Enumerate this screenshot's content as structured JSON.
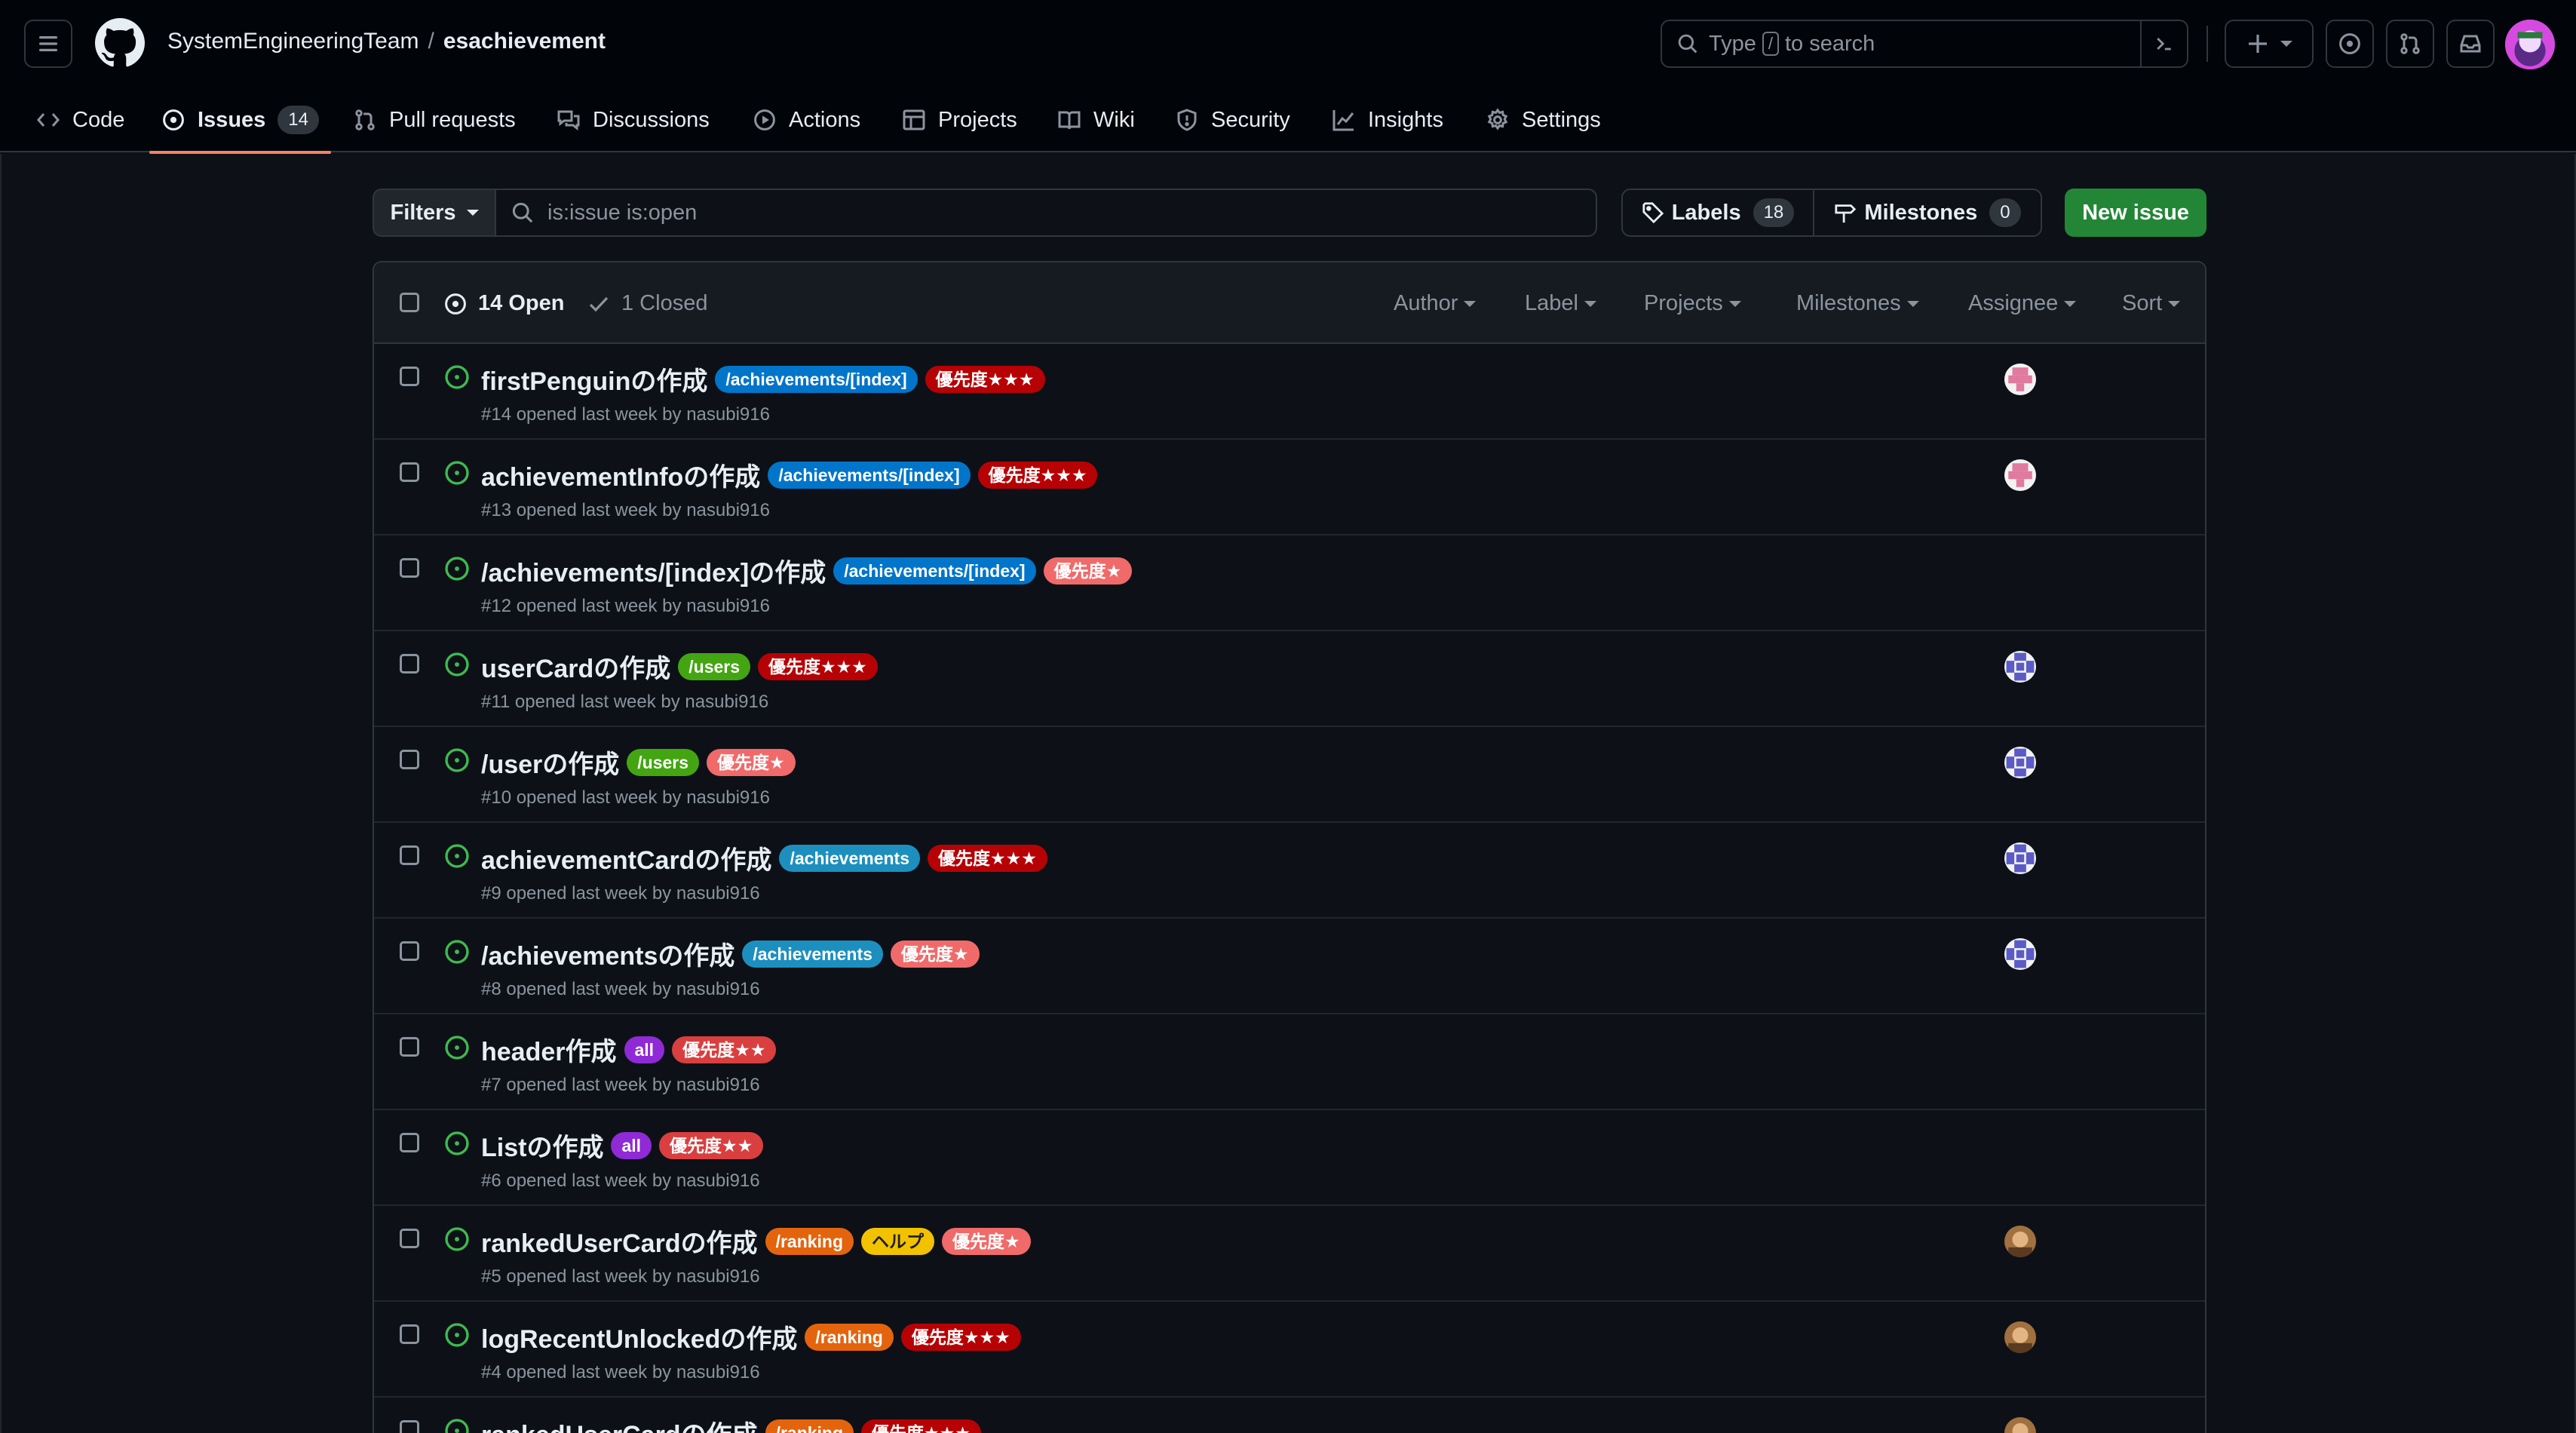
{
  "header": {
    "owner": "SystemEngineeringTeam",
    "separator": "/",
    "repo": "esachievement",
    "search": {
      "prefix": "Type",
      "key": "/",
      "suffix": "to search"
    }
  },
  "nav": [
    {
      "label": "Code",
      "icon": "code-icon"
    },
    {
      "label": "Issues",
      "icon": "issue-opened-icon",
      "count": "14",
      "active": true
    },
    {
      "label": "Pull requests",
      "icon": "git-pull-request-icon"
    },
    {
      "label": "Discussions",
      "icon": "comment-discussion-icon"
    },
    {
      "label": "Actions",
      "icon": "play-icon"
    },
    {
      "label": "Projects",
      "icon": "table-icon"
    },
    {
      "label": "Wiki",
      "icon": "book-icon"
    },
    {
      "label": "Security",
      "icon": "shield-icon"
    },
    {
      "label": "Insights",
      "icon": "graph-icon"
    },
    {
      "label": "Settings",
      "icon": "gear-icon"
    }
  ],
  "toolbar": {
    "filters_label": "Filters",
    "query": "is:issue is:open",
    "labels_label": "Labels",
    "labels_count": "18",
    "milestones_label": "Milestones",
    "milestones_count": "0",
    "new_issue_label": "New issue"
  },
  "list_header": {
    "open_label": "14 Open",
    "closed_label": "1 Closed",
    "filters": [
      "Author",
      "Label",
      "Projects",
      "Milestones",
      "Assignee",
      "Sort"
    ]
  },
  "labels_palette": {
    "achievements-index": {
      "bg": "#0075ca",
      "fg": "#ffffff"
    },
    "achievements": {
      "bg": "#1d8fbf",
      "fg": "#ffffff"
    },
    "users": {
      "bg": "#44a512",
      "fg": "#ffffff"
    },
    "all": {
      "bg": "#8f2ad6",
      "fg": "#ffffff"
    },
    "ranking": {
      "bg": "#e4640d",
      "fg": "#ffffff"
    },
    "help": {
      "bg": "#f2c200",
      "fg": "#1f1f1f"
    },
    "p3": {
      "bg": "#b60205",
      "fg": "#ffffff"
    },
    "p2": {
      "bg": "#d93f3f",
      "fg": "#ffffff"
    },
    "p1": {
      "bg": "#f06a6a",
      "fg": "#ffffff"
    }
  },
  "issues": [
    {
      "title": "firstPenguinの作成",
      "labels": [
        {
          "text": "/achievements/[index]",
          "key": "achievements-index"
        },
        {
          "text": "優先度★★★",
          "key": "p3"
        }
      ],
      "meta": "#14 opened last week by nasubi916",
      "avatar": "pink"
    },
    {
      "title": "achievementInfoの作成",
      "labels": [
        {
          "text": "/achievements/[index]",
          "key": "achievements-index"
        },
        {
          "text": "優先度★★★",
          "key": "p3"
        }
      ],
      "meta": "#13 opened last week by nasubi916",
      "avatar": "pink"
    },
    {
      "title": "/achievements/[index]の作成",
      "labels": [
        {
          "text": "/achievements/[index]",
          "key": "achievements-index"
        },
        {
          "text": "優先度★",
          "key": "p1"
        }
      ],
      "meta": "#12 opened last week by nasubi916",
      "avatar": ""
    },
    {
      "title": "userCardの作成",
      "labels": [
        {
          "text": "/users",
          "key": "users"
        },
        {
          "text": "優先度★★★",
          "key": "p3"
        }
      ],
      "meta": "#11 opened last week by nasubi916",
      "avatar": "blue"
    },
    {
      "title": "/userの作成",
      "labels": [
        {
          "text": "/users",
          "key": "users"
        },
        {
          "text": "優先度★",
          "key": "p1"
        }
      ],
      "meta": "#10 opened last week by nasubi916",
      "avatar": "blue"
    },
    {
      "title": "achievementCardの作成",
      "labels": [
        {
          "text": "/achievements",
          "key": "achievements"
        },
        {
          "text": "優先度★★★",
          "key": "p3"
        }
      ],
      "meta": "#9 opened last week by nasubi916",
      "avatar": "blue"
    },
    {
      "title": "/achievementsの作成",
      "labels": [
        {
          "text": "/achievements",
          "key": "achievements"
        },
        {
          "text": "優先度★",
          "key": "p1"
        }
      ],
      "meta": "#8 opened last week by nasubi916",
      "avatar": "blue"
    },
    {
      "title": "header作成",
      "labels": [
        {
          "text": "all",
          "key": "all"
        },
        {
          "text": "優先度★★",
          "key": "p2"
        }
      ],
      "meta": "#7 opened last week by nasubi916",
      "avatar": ""
    },
    {
      "title": "Listの作成",
      "labels": [
        {
          "text": "all",
          "key": "all"
        },
        {
          "text": "優先度★★",
          "key": "p2"
        }
      ],
      "meta": "#6 opened last week by nasubi916",
      "avatar": ""
    },
    {
      "title": "rankedUserCardの作成",
      "labels": [
        {
          "text": "/ranking",
          "key": "ranking"
        },
        {
          "text": "ヘルプ",
          "key": "help"
        },
        {
          "text": "優先度★",
          "key": "p1"
        }
      ],
      "meta": "#5 opened last week by nasubi916",
      "avatar": "photo"
    },
    {
      "title": "logRecentUnlockedの作成",
      "labels": [
        {
          "text": "/ranking",
          "key": "ranking"
        },
        {
          "text": "優先度★★★",
          "key": "p3"
        }
      ],
      "meta": "#4 opened last week by nasubi916",
      "avatar": "photo"
    },
    {
      "title": "rankedUserCardの作成",
      "labels": [
        {
          "text": "/ranking",
          "key": "ranking"
        },
        {
          "text": "優先度★★★",
          "key": "p3"
        }
      ],
      "meta": "",
      "avatar": "photo"
    }
  ]
}
